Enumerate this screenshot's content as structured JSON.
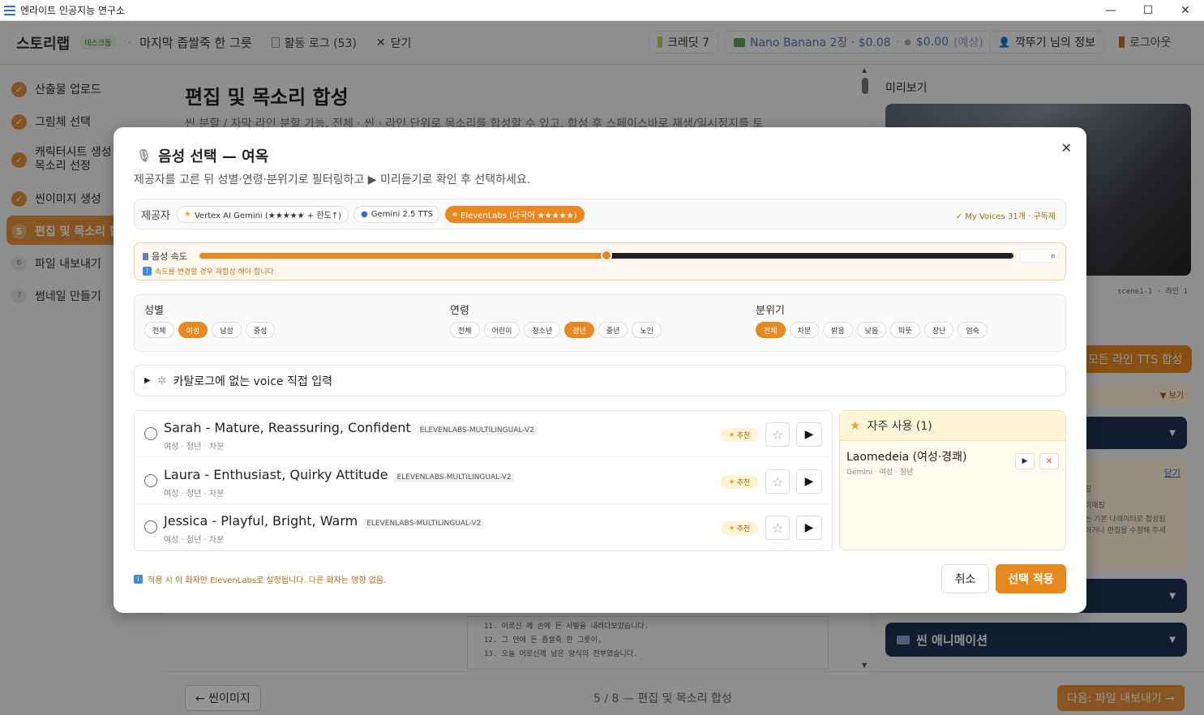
{
  "window": {
    "title": "엔라이트 인공지능 연구소",
    "minimize": "—",
    "maximize": "☐",
    "close": "✕"
  },
  "topbar": {
    "brand": "스토리랩",
    "badge": "데스크톱",
    "project": "마지막 좁쌀죽 한 그릇",
    "activity_log": "활동 로그 (53)",
    "close": "닫기",
    "credits": "크레딧 7",
    "cost_line": "Nano Banana 2장 · $0.08",
    "cost_est": "$0.00",
    "cost_est_suffix": "(예상)",
    "user": "깍뚜기 님의 정보",
    "logout": "로그아웃"
  },
  "sidebar": {
    "items": [
      {
        "label": "산출물 업로드",
        "mark": "✓"
      },
      {
        "label": "그림체 선택",
        "mark": "✓"
      },
      {
        "label": "캐릭터시트 생성",
        "label2": "목소리 선정",
        "mark": "✓"
      },
      {
        "label": "씬이미지 생성",
        "mark": "✓"
      },
      {
        "label": "편집 및 목소리 합",
        "mark": "5"
      },
      {
        "label": "파일 내보내기",
        "mark": "6"
      },
      {
        "label": "썸네일 만들기",
        "mark": "7"
      }
    ]
  },
  "main": {
    "title": "편집 및 목소리 합성",
    "subtitle": "씬 분할 / 자막 라인 분할 가능. 전체 · 씬 · 라인 단위로 목소리를 합성할 수 있고, 합성 후 스페이스바로 재생/일시정지를 토",
    "script_lines": [
      "11. 어르신 께 손에 든 사발을 내려다보았습니다.",
      "12. 그 안에 든 좁쌀죽 한 그릇이,",
      "13. 오늘 어르신께 남은 양식의 전부였습니다."
    ]
  },
  "preview": {
    "label": "미리보기",
    "scene_tag": "scene1-1 · 라인 1",
    "all_tts": "모든 라인 TTS 합성",
    "show": "▼ 보기",
    "close_link": "닫기",
    "anim": "씬 애니메이션",
    "notes": [
      "링",
      "미매핑",
      "는 기본 나레이터로 합성됨",
      "하거나 편집용 수정해 주세"
    ]
  },
  "bottom": {
    "prev": "← 씬이미지",
    "page_indicator": "5 / 8 — 편집 및 목소리 합성",
    "next": "다음: 파일 내보내기 →"
  },
  "modal": {
    "title": "음성 선택 — 여옥",
    "subtitle": "제공자를 고른 뒤 성별·연령·분위기로 필터링하고 ▶ 미리듣기로 확인 후 선택하세요.",
    "provider_label": "제공자",
    "providers": [
      {
        "label": "Vertex AI Gemini (★★★★★ + 한도↑)",
        "icon": "★",
        "active": false
      },
      {
        "label": "Gemini 2.5 TTS",
        "icon": "●",
        "active": false
      },
      {
        "label": "ElevenLabs (다국어 ★★★★★)",
        "icon": "●",
        "active": true
      }
    ],
    "my_voices": "✓ My Voices 31개 · 구독제",
    "speed_label": "음성 속도",
    "speed_value": 0.5,
    "speed_input": "e",
    "speed_note": "속도를 변경할 경우 재합성 해야 합니다.",
    "filters": [
      {
        "label": "성별",
        "options": [
          "전체",
          "여성",
          "남성",
          "중성"
        ],
        "selected": 1
      },
      {
        "label": "연령",
        "options": [
          "전체",
          "어린이",
          "청소년",
          "청년",
          "중년",
          "노인"
        ],
        "selected": 3
      },
      {
        "label": "분위기",
        "options": [
          "전체",
          "차분",
          "밝음",
          "낮음",
          "따뜻",
          "장난",
          "엄숙"
        ],
        "selected": 0
      }
    ],
    "custom_voice": "카탈로그에 없는 voice 직접 입력",
    "voices": [
      {
        "name": "Sarah - Mature, Reassuring, Confident",
        "model": "ELEVENLABS-MULTILINGUAL-V2",
        "meta": "여성 · 청년 · 차분",
        "badge": "추천"
      },
      {
        "name": "Laura - Enthusiast, Quirky Attitude",
        "model": "ELEVENLABS-MULTILINGUAL-V2",
        "meta": "여성 · 청년 · 차분",
        "badge": "추천"
      },
      {
        "name": "Jessica - Playful, Bright, Warm",
        "model": "ELEVENLABS-MULTILINGUAL-V2",
        "meta": "여성 · 청년 · 차분",
        "badge": "추천"
      }
    ],
    "favorites_title": "자주 사용 (1)",
    "favorite": {
      "name": "Laomedeia (여성·경쾌)",
      "meta": "Gemini · 여성 · 청년"
    },
    "note": "적용 시 이 화자만 ElevenLabs로 설정됩니다. 다른 화자는 영향 없음.",
    "cancel": "취소",
    "apply": "선택 적용"
  },
  "colors": {
    "accent": "#e8891f",
    "active_side": "#e8933b",
    "dark_btn": "#1f3354"
  }
}
